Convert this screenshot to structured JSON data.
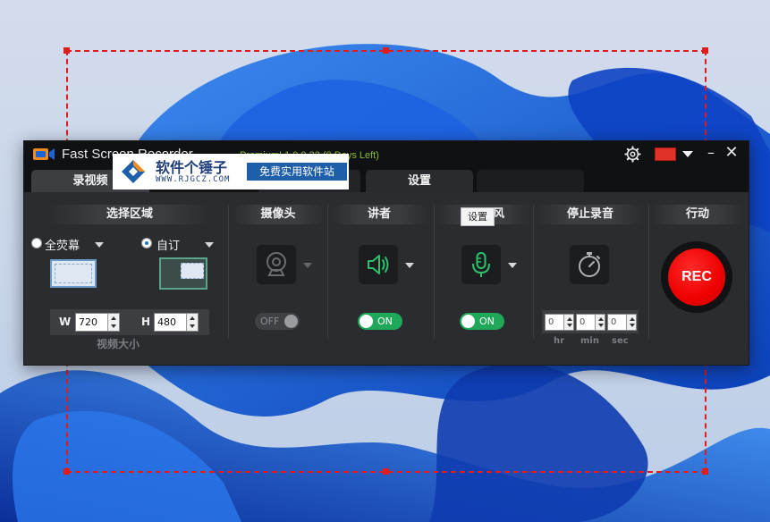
{
  "window": {
    "title": "Fast Screen Recorder",
    "version": "Premium! 1.0.9.32 (9 Days Left)"
  },
  "watermark": {
    "name": "软件个锤子",
    "url": "WWW.RJGCZ.COM",
    "slogan": "免费实用软件站"
  },
  "tabs": {
    "record": "录视频",
    "settings": "设置"
  },
  "area": {
    "header": "选择区域",
    "fullscreen_label": "全荧幕",
    "custom_label": "自订",
    "selected": "custom",
    "width_label": "W",
    "width_value": "720",
    "height_label": "H",
    "height_value": "480",
    "video_size_label": "视频大小"
  },
  "webcam": {
    "header": "摄像头",
    "toggle": "OFF"
  },
  "speaker": {
    "header": "讲者",
    "toggle": "ON"
  },
  "microphone": {
    "header": "风",
    "tooltip": "设置",
    "toggle": "ON"
  },
  "stop_recording": {
    "header": "停止录音",
    "hr_value": "0",
    "min_value": "0",
    "sec_value": "0",
    "hr_label": "hr",
    "min_label": "min",
    "sec_label": "sec"
  },
  "action": {
    "header": "行动",
    "rec_label": "REC"
  },
  "colors": {
    "accent_green": "#1fa85a",
    "rec_red": "#e00000",
    "selection_red": "#e01c1c",
    "version_green": "#8bbb30"
  },
  "icons": {
    "gear": "gear-icon",
    "flag": "china-flag-icon",
    "webcam": "webcam-icon",
    "speaker": "speaker-icon",
    "microphone": "microphone-icon",
    "stopwatch": "stopwatch-icon"
  }
}
